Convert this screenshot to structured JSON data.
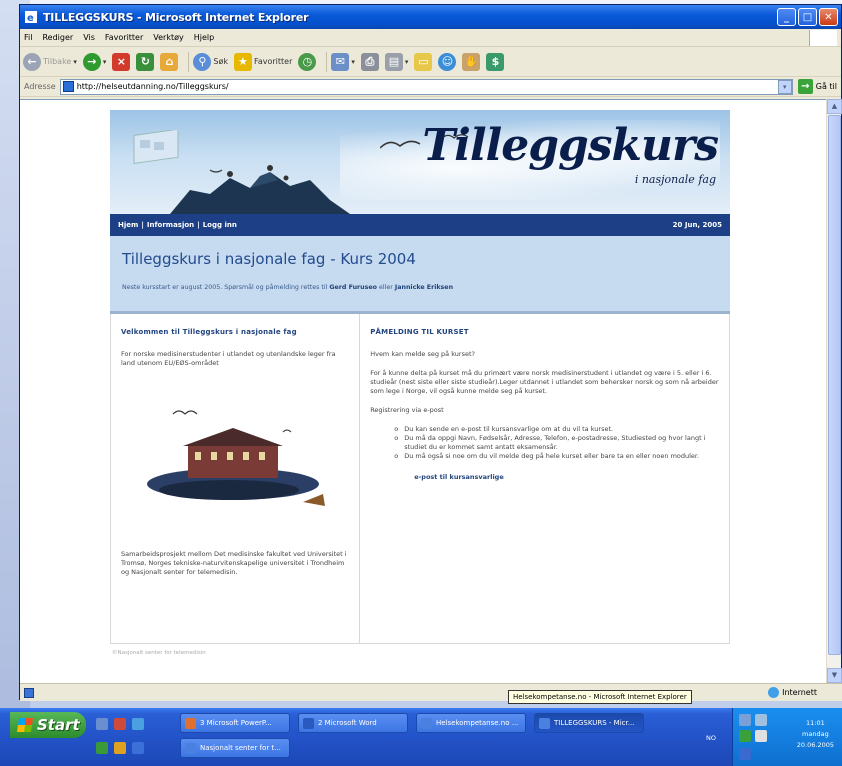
{
  "window": {
    "title": "TILLEGGSKURS - Microsoft Internet Explorer",
    "controls": {
      "minimize": "_",
      "maximize": "□",
      "close": "✕"
    }
  },
  "menubar": [
    "Fil",
    "Rediger",
    "Vis",
    "Favoritter",
    "Verktøy",
    "Hjelp"
  ],
  "toolbar": {
    "back": "Tilbake",
    "search": "Søk",
    "favorites": "Favoritter"
  },
  "address": {
    "label": "Adresse",
    "url": "http://helseutdanning.no/Tilleggskurs/",
    "go": "Gå til"
  },
  "banner": {
    "logo": "Tilleggskurs",
    "logo_sub": "i nasjonale fag"
  },
  "nav": {
    "links": [
      "Hjem",
      "Informasjon",
      "Logg inn"
    ],
    "separator": "|",
    "date": "20 Jun, 2005"
  },
  "intro": {
    "heading": "Tilleggskurs i nasjonale fag - Kurs 2004",
    "next_text": "Neste kursstart er august 2005. Spørsmål og påmelding rettes til",
    "contact1": "Gerd Furuseo",
    "or": "eller",
    "contact2": "Jannicke Eriksen"
  },
  "left": {
    "heading": "Velkommen til Tilleggskurs i nasjonale fag",
    "audience": "For norske medisinerstudenter i utlandet og utenlandske leger fra land utenom EU/EØS-området",
    "collab": "Samarbeidsprosjekt mellom Det medisinske fakultet ved Universitet i Tromsø, Norges tekniske-naturvitenskapelige universitet i Trondheim og Nasjonalt senter for telemedisin."
  },
  "right": {
    "heading": "PÅMELDING TIL KURSET",
    "q": "Hvem kan melde seg på kurset?",
    "p1": "For å kunne delta på kurset må du primært være norsk medisinerstudent i utlandet og være i 5. eller i 6. studieår (nest siste eller siste studieår).Leger utdannet i utlandet som behersker norsk og som nå arbeider som lege i Norge, vil også kunne melde seg på kurset.",
    "reg": "Registrering via e-post",
    "items": [
      "Du kan sende en e-post til kursansvarlige om at du vil ta kurset.",
      "Du må da oppgi Navn, Fødselsår, Adresse, Telefon, e-postadresse, Studiested og hvor langt i studiet du er kommet samt antatt eksamensår.",
      "Du må også si noe om du vil melde deg på hele kurset eller bare ta en eller noen moduler."
    ],
    "email_link": "e-post til kursansvarlige"
  },
  "footer": "©Nasjonalt senter for telemedisin",
  "status": {
    "zone": "Internett",
    "tooltip": "Helsekompetanse.no - Microsoft Internet Explorer"
  },
  "taskbar": {
    "start": "Start",
    "buttons": [
      "3 Microsoft PowerP...",
      "2 Microsoft Word",
      "Helsekompetanse.no ...",
      "TILLEGGSKURS - Micr...",
      "Nasjonalt senter for t..."
    ],
    "lang": "NO",
    "time": "11:01",
    "day": "mandag",
    "date": "20.06.2005"
  },
  "colors": {
    "navy": "#1c3f86",
    "intro_bg": "#c6dbef",
    "heading": "#244b8f"
  }
}
